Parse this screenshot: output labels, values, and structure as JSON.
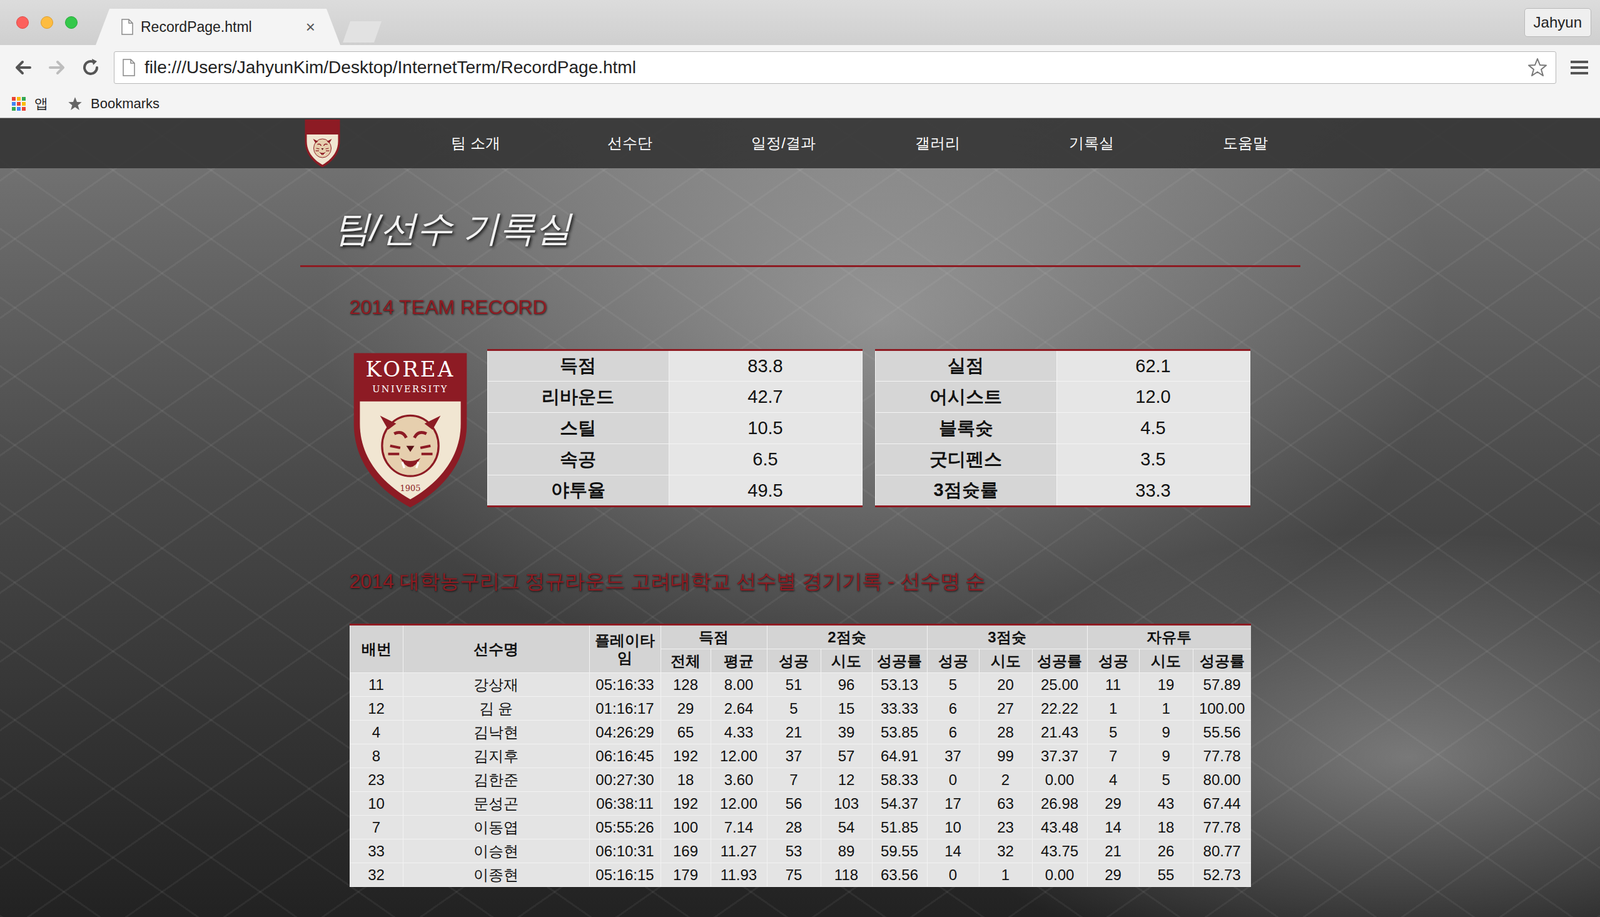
{
  "tabs": [
    {
      "label": "RecordPage.html",
      "close": "×",
      "selected": true
    }
  ],
  "profile": {
    "label": "Jahyun"
  },
  "navigation": {
    "back": {
      "disabled": false
    },
    "forward": {
      "disabled": true
    }
  },
  "address": {
    "value": "file:///Users/JahyunKim/Desktop/InternetTerm/RecordPage.html",
    "starred": false
  },
  "bookmarks": [
    {
      "label": "앱"
    },
    {
      "label": "Bookmarks"
    }
  ],
  "site_nav": {
    "items": [
      {
        "label": "팀 소개"
      },
      {
        "label": "선수단"
      },
      {
        "label": "일정/결과"
      },
      {
        "label": "갤러리"
      },
      {
        "label": "기록실"
      },
      {
        "label": "도움말"
      }
    ]
  },
  "page": {
    "title": "팀/선수 기록실"
  },
  "logo": {
    "name": "KOREA",
    "sub": "UNIVERSITY",
    "year": "1905"
  },
  "team_record": {
    "heading": "2014 TEAM RECORD",
    "tables": [
      [
        {
          "label": "득점",
          "value": "83.8"
        },
        {
          "label": "리바운드",
          "value": "42.7"
        },
        {
          "label": "스틸",
          "value": "10.5"
        },
        {
          "label": "속공",
          "value": "6.5"
        },
        {
          "label": "야투율",
          "value": "49.5"
        }
      ],
      [
        {
          "label": "실점",
          "value": "62.1"
        },
        {
          "label": "어시스트",
          "value": "12.0"
        },
        {
          "label": "블록슛",
          "value": "4.5"
        },
        {
          "label": "굿디펜스",
          "value": "3.5"
        },
        {
          "label": "3점슛률",
          "value": "33.3"
        }
      ]
    ]
  },
  "player_record": {
    "heading": "2014 대학농구리그 정규라운드 고려대학교 선수별 경기기록 - 선수명 순",
    "header": [
      {
        "label": "배번",
        "sub": []
      },
      {
        "label": "선수명",
        "sub": []
      },
      {
        "label": "플레이타임",
        "sub": []
      },
      {
        "label": "득점",
        "sub": [
          "전체",
          "평균"
        ]
      },
      {
        "label": "2점슛",
        "sub": [
          "성공",
          "시도",
          "성공률"
        ]
      },
      {
        "label": "3점슛",
        "sub": [
          "성공",
          "시도",
          "성공률"
        ]
      },
      {
        "label": "자유투",
        "sub": [
          "성공",
          "시도",
          "성공률"
        ]
      }
    ],
    "rows": [
      [
        "11",
        "강상재",
        "05:16:33",
        "128",
        "8.00",
        "51",
        "96",
        "53.13",
        "5",
        "20",
        "25.00",
        "11",
        "19",
        "57.89"
      ],
      [
        "12",
        "김 윤",
        "01:16:17",
        "29",
        "2.64",
        "5",
        "15",
        "33.33",
        "6",
        "27",
        "22.22",
        "1",
        "1",
        "100.00"
      ],
      [
        "4",
        "김낙현",
        "04:26:29",
        "65",
        "4.33",
        "21",
        "39",
        "53.85",
        "6",
        "28",
        "21.43",
        "5",
        "9",
        "55.56"
      ],
      [
        "8",
        "김지후",
        "06:16:45",
        "192",
        "12.00",
        "37",
        "57",
        "64.91",
        "37",
        "99",
        "37.37",
        "7",
        "9",
        "77.78"
      ],
      [
        "23",
        "김한준",
        "00:27:30",
        "18",
        "3.60",
        "7",
        "12",
        "58.33",
        "0",
        "2",
        "0.00",
        "4",
        "5",
        "80.00"
      ],
      [
        "10",
        "문성곤",
        "06:38:11",
        "192",
        "12.00",
        "56",
        "103",
        "54.37",
        "17",
        "63",
        "26.98",
        "29",
        "43",
        "67.44"
      ],
      [
        "7",
        "이동엽",
        "05:55:26",
        "100",
        "7.14",
        "28",
        "54",
        "51.85",
        "10",
        "23",
        "43.48",
        "14",
        "18",
        "77.78"
      ],
      [
        "33",
        "이승현",
        "06:10:31",
        "169",
        "11.27",
        "53",
        "89",
        "59.55",
        "14",
        "32",
        "43.75",
        "21",
        "26",
        "80.77"
      ],
      [
        "32",
        "이종현",
        "05:16:15",
        "179",
        "11.93",
        "75",
        "118",
        "63.56",
        "0",
        "1",
        "0.00",
        "29",
        "55",
        "52.73"
      ]
    ]
  }
}
